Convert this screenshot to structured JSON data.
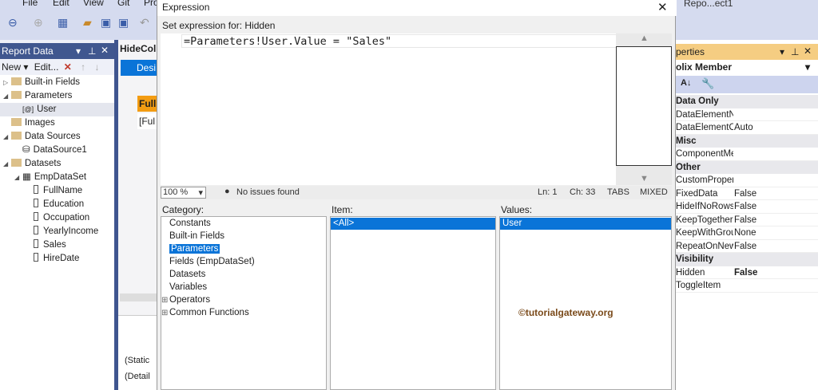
{
  "menu": [
    "File",
    "Edit",
    "View",
    "Git",
    "Pro"
  ],
  "window_title": "Repo...ect1",
  "report_data": {
    "title": "Report Data",
    "new_label": "New",
    "edit_label": "Edit...",
    "tree": [
      {
        "label": "Built-in Fields",
        "kind": "folder",
        "level": 0,
        "exp": "▷"
      },
      {
        "label": "Parameters",
        "kind": "folder",
        "level": 0,
        "exp": "◢"
      },
      {
        "label": "User",
        "kind": "param",
        "level": 1
      },
      {
        "label": "Images",
        "kind": "folder",
        "level": 0
      },
      {
        "label": "Data Sources",
        "kind": "folder",
        "level": 0,
        "exp": "◢"
      },
      {
        "label": "DataSource1",
        "kind": "ds",
        "level": 1
      },
      {
        "label": "Datasets",
        "kind": "folder",
        "level": 0,
        "exp": "◢"
      },
      {
        "label": "EmpDataSet",
        "kind": "table",
        "level": 1,
        "exp": "◢"
      },
      {
        "label": "FullName",
        "kind": "field",
        "level": 2
      },
      {
        "label": "Education",
        "kind": "field",
        "level": 2
      },
      {
        "label": "Occupation",
        "kind": "field",
        "level": 2
      },
      {
        "label": "YearlyIncome",
        "kind": "field",
        "level": 2
      },
      {
        "label": "Sales",
        "kind": "field",
        "level": 2
      },
      {
        "label": "HireDate",
        "kind": "field",
        "level": 2
      }
    ]
  },
  "designer": {
    "tab": "HideCol",
    "design_tab": "Desi",
    "header_cell": "Full",
    "data_cell": "[Ful",
    "groups": [
      "(Static",
      "(Detail"
    ]
  },
  "dialog": {
    "title": "Expression",
    "set_label": "Set expression for: Hidden",
    "expression": "=Parameters!User.Value = \"Sales\"",
    "zoom": "100 %",
    "issues": "No issues found",
    "ln": "Ln: 1",
    "ch": "Ch: 33",
    "tabs": "TABS",
    "mixed": "MIXED",
    "category_label": "Category:",
    "item_label": "Item:",
    "values_label": "Values:",
    "categories": [
      {
        "label": "Constants"
      },
      {
        "label": "Built-in Fields"
      },
      {
        "label": "Parameters",
        "selected": true
      },
      {
        "label": "Fields (EmpDataSet)"
      },
      {
        "label": "Datasets"
      },
      {
        "label": "Variables"
      },
      {
        "label": "Operators",
        "expander": "+"
      },
      {
        "label": "Common Functions",
        "expander": "+"
      }
    ],
    "items": [
      "<All>"
    ],
    "values": [
      "User"
    ],
    "watermark": "©tutorialgateway.org"
  },
  "properties": {
    "title": "perties",
    "object": "olix Member",
    "rows": [
      {
        "cat": "Data Only"
      },
      {
        "name": "DataElementNa",
        "value": ""
      },
      {
        "name": "DataElementOu",
        "value": "Auto"
      },
      {
        "cat": "Misc"
      },
      {
        "name": "ComponentMe",
        "value": ""
      },
      {
        "cat": "Other"
      },
      {
        "name": "CustomPropert",
        "value": ""
      },
      {
        "name": "FixedData",
        "value": "False"
      },
      {
        "name": "HideIfNoRows",
        "value": "False"
      },
      {
        "name": "KeepTogether",
        "value": "False"
      },
      {
        "name": "KeepWithGroup",
        "value": "None"
      },
      {
        "name": "RepeatOnNewP",
        "value": "False"
      },
      {
        "cat": "Visibility"
      },
      {
        "name": "Hidden",
        "value": "False",
        "bold": true
      },
      {
        "name": "ToggleItem",
        "value": ""
      }
    ]
  }
}
